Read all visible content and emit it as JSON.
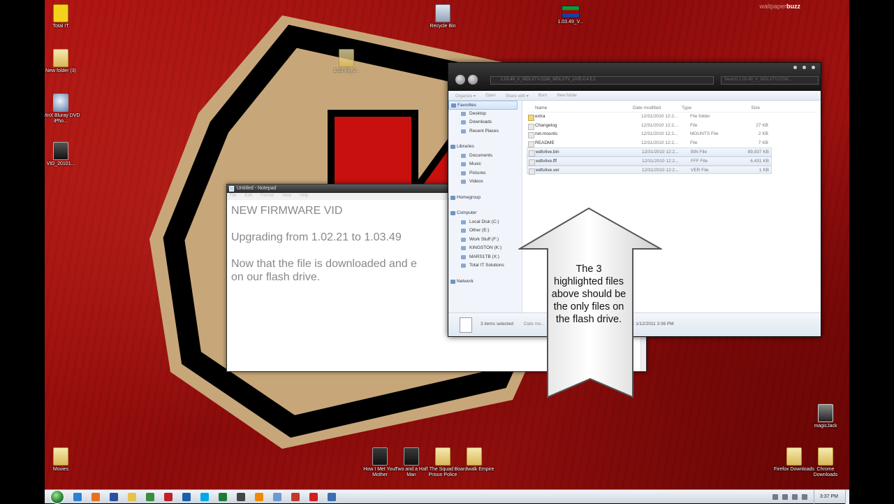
{
  "desktop": {
    "watermark_a": "wallpaper",
    "watermark_b": "buzz",
    "icons": [
      {
        "label": "Total IT"
      },
      {
        "label": "New folder (3)"
      },
      {
        "label": "WinX Bluray DVD iPho..."
      },
      {
        "label": "VID_20101..."
      },
      {
        "label": "Recycle Bin"
      },
      {
        "label": "1.03.49_V..."
      },
      {
        "label": "1.03.49_V..."
      },
      {
        "label": "Movies"
      },
      {
        "label": "How I Met Your Mother"
      },
      {
        "label": "Two and a Half Man"
      },
      {
        "label": "The Squad - Prison Police"
      },
      {
        "label": "Boardwalk Empire"
      },
      {
        "label": "Firefox Downloads"
      },
      {
        "label": "Chrome Downloads"
      },
      {
        "label": "magicJack"
      }
    ]
  },
  "notepad": {
    "title": "Untitled - Notepad",
    "menu": [
      "File",
      "Edit",
      "Format",
      "View",
      "Help"
    ],
    "text": "NEW FIRMWARE VID\n\nUpgrading from 1.02.21 to 1.03.49\n\nNow that the file is downloaded and e\non our flash drive."
  },
  "explorer": {
    "address": "1.03.49_V_WDLXTV.COM_WDLXTV_LIVE-0.4.5.2",
    "search_placeholder": "Search 1.03.49_V_WDLXTV.COM...",
    "toolbar": [
      "Organize ▾",
      "Open",
      "Share with ▾",
      "Burn",
      "New folder"
    ],
    "nav": [
      {
        "label": "Favorites",
        "type": "grp",
        "selected": true
      },
      {
        "label": "Desktop",
        "type": "it"
      },
      {
        "label": "Downloads",
        "type": "it"
      },
      {
        "label": "Recent Places",
        "type": "it"
      },
      {
        "label": "",
        "type": "gap"
      },
      {
        "label": "Libraries",
        "type": "grp"
      },
      {
        "label": "Documents",
        "type": "it"
      },
      {
        "label": "Music",
        "type": "it"
      },
      {
        "label": "Pictures",
        "type": "it"
      },
      {
        "label": "Videos",
        "type": "it"
      },
      {
        "label": "",
        "type": "gap"
      },
      {
        "label": "Homegroup",
        "type": "grp"
      },
      {
        "label": "",
        "type": "gap"
      },
      {
        "label": "Computer",
        "type": "grp"
      },
      {
        "label": "Local Disk (C:)",
        "type": "it"
      },
      {
        "label": "Other (E:)",
        "type": "it"
      },
      {
        "label": "Work Stuff (F:)",
        "type": "it"
      },
      {
        "label": "KINGSTON (K:)",
        "type": "it"
      },
      {
        "label": "MARS1TB (X:)",
        "type": "it"
      },
      {
        "label": "Total IT Solutions",
        "type": "it"
      },
      {
        "label": "",
        "type": "gap"
      },
      {
        "label": "Network",
        "type": "grp"
      }
    ],
    "columns": [
      "Name",
      "Date modified",
      "Type",
      "Size"
    ],
    "files": [
      {
        "name": "extra",
        "date": "12/31/2010 12:2...",
        "type": "File folder",
        "size": "",
        "dir": true,
        "hl": false
      },
      {
        "name": "Changelog",
        "date": "12/31/2010 12:2...",
        "type": "File",
        "size": "27 KB",
        "dir": false,
        "hl": false
      },
      {
        "name": "net.mounts",
        "date": "12/31/2010 12:2...",
        "type": "MOUNTS File",
        "size": "2 KB",
        "dir": false,
        "hl": false
      },
      {
        "name": "README",
        "date": "12/31/2010 12:2...",
        "type": "File",
        "size": "7 KB",
        "dir": false,
        "hl": false
      },
      {
        "name": "wdtvlive.bin",
        "date": "12/31/2010 12:2...",
        "type": "BIN File",
        "size": "89,937 KB",
        "dir": false,
        "hl": true
      },
      {
        "name": "wdtvlive.fff",
        "date": "12/31/2010 12:2...",
        "type": "FFF File",
        "size": "6,431 KB",
        "dir": false,
        "hl": true
      },
      {
        "name": "wdtvlive.ver",
        "date": "12/31/2010 12:2...",
        "type": "VER File",
        "size": "1 KB",
        "dir": false,
        "hl": true
      }
    ],
    "status_selected": "3 items selected",
    "status_date_label": "Date mo...",
    "status_created": "ated: 1/12/2011 3:36 PM"
  },
  "callout": {
    "text": "The 3 highlighted files above should be the only files on the flash drive."
  },
  "taskbar": {
    "clock": "3:37 PM",
    "icons": [
      "ie-icon",
      "firefox-icon",
      "media-icon",
      "folder-icon",
      "chrome-icon",
      "acrobat-icon",
      "photoshop-icon",
      "skype-icon",
      "excel-icon",
      "magicjack-icon",
      "vlc-icon",
      "blocks-icon",
      "butterfly-icon",
      "x-icon",
      "app-icon"
    ]
  }
}
